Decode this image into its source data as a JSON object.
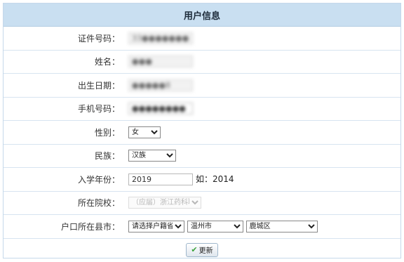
{
  "header": {
    "title": "用户信息"
  },
  "form": {
    "id_number": {
      "label": "证件号码：",
      "value": "33●●●●●●●●●●"
    },
    "name": {
      "label": "姓名：",
      "value": "●●●"
    },
    "birth": {
      "label": "出生日期：",
      "value": "●●●●●8"
    },
    "phone": {
      "label": "手机号码：",
      "value": "●●●●●●●●"
    },
    "gender": {
      "label": "性别：",
      "selected": "女"
    },
    "ethnicity": {
      "label": "民族：",
      "selected": "汉族"
    },
    "enroll_year": {
      "label": "入学年份：",
      "value": "2019",
      "hint": "如：2014"
    },
    "college": {
      "label": "所在院校：",
      "selected": "（应届）浙江药科职业大学"
    },
    "hukou": {
      "label": "户口所在县市：",
      "province": "请选择户籍省份",
      "city": "温州市",
      "district": "鹿城区"
    }
  },
  "actions": {
    "update_label": "更新"
  }
}
